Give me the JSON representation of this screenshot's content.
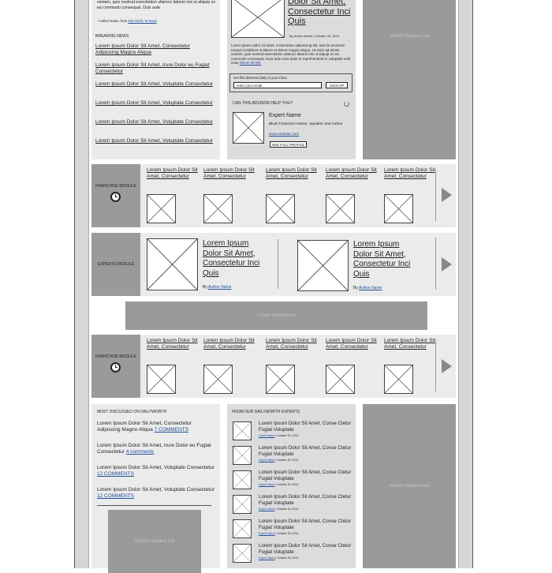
{
  "top_left": {
    "quote_text": "veniam, quis nostrud exercitation ullamco laboris nisi ut aliquip ex ea commodo consequat. Duis aute",
    "quote_attrib": "--Author Name, from ",
    "quote_link": "DW Article To Read",
    "breaking_title": "BREAKING NEWS",
    "breaking": [
      "Lorem Ipsum Dolor Sit Amet, Consectetur Adipiscing Magno Aliqua",
      "Lorem Ipsum Dolor Sit Amet, Irure Dolor eu Fugiat Consectetur",
      "Lorem Ipsum Dolor Sit Amet, Voluptate Consectetur",
      "Lorem Ipsum Dolor Sit Amet, Voluptate Consectetur",
      "Lorem Ipsum Dolor Sit Amet, Voluptate Consectetur",
      "Lorem Ipsum Dolor Sit Amet, Voluptate Consectetur"
    ]
  },
  "top_middle": {
    "headline": "Dolor Sit Amet, Consectetur Inci Quis",
    "byline": "By Author Name | October 26, 2014",
    "body": "Lorem ipsum dolor sit amet, consectetur adipisicing elit, sed do eiusmod tempor incididunt ut labore et dolore magna aliqua. Ut enim ad minim veniam, quis nostrud exercitation ullamco laboris nisi ut aliquip ex ea commodo consequat. Duis aute irure dolor in reprehenderit in voluptate velit esse ",
    "read_more": "READ MORE",
    "inbox_label": "Get this delivered daily to your inbox:",
    "email_placeholder": "enter your email",
    "signup": "SIGN UP",
    "advisor_title": "CAN THIS ADVISOR HELP YOU?",
    "expert_name": "Expert Name",
    "expert_desc": "Blurb Financial Advisor, Speaker and Author",
    "expert_site": "www.website.com",
    "see_profile": "SEE FULL PROFILE"
  },
  "ads": {
    "top_right": "300x600 Standard Unit",
    "leaderboard": "970x90 Standard Unit",
    "bottom_right": "300x600 Standard Unit",
    "bottom_left": "300x250 Standard Unit"
  },
  "franchise1": {
    "label": "FRANCHISE MODULE",
    "items": [
      "Lorem Ipsum Dolor Sit Amet, Consectetur",
      "Lorem Ipsum Dolor Sit Amet, Consectetur",
      "Lorem Ipsum Dolor Sit Amet, Consectetur",
      "Lorem Ipsum Dolor Sit Amet, Consectetur",
      "Lorem Ipsum Dolor Sit Amet, Consectetur"
    ]
  },
  "experts": {
    "label": "EXPERTS MODULE",
    "items": [
      {
        "title": "Lorem Ipsum Dolor Sit Amet, Consectetur Inci Quis",
        "by": "By ",
        "author": "Author Name"
      },
      {
        "title": "Lorem Ipsum Dolor Sit Amet, Consectetur Inci Quis",
        "by": "By ",
        "author": "Author Name"
      }
    ]
  },
  "franchise2": {
    "label": "FRANCHISE MODULE",
    "items": [
      "Lorem Ipsum Dolor Sit Amet, Consectetur",
      "Lorem Ipsum Dolor Sit Amet, Consectetur",
      "Lorem Ipsum Dolor Sit Amet, Consectetur",
      "Lorem Ipsum Dolor Sit Amet, Consectetur",
      "Lorem Ipsum Dolor Sit Amet, Consectetur"
    ]
  },
  "most_discussed": {
    "title": "MOST DISCUSSED ON DAILYWORTH",
    "items": [
      {
        "text": "Lorem Ipsum Dolor Sit Amet, Consectetur Adipiscing Magno Aliqua ",
        "comments": "7 COMMENTS"
      },
      {
        "text": "Lorem Ipsum Dolor Sit Amet, Irure Dolor eu Fugiat Consectetur ",
        "comments": "4 comments"
      },
      {
        "text": "Lorem Ipsum Dolor Sit Amet, Voluptate Consectetur ",
        "comments": "12 COMMENTS"
      },
      {
        "text": "Lorem Ipsum Dolor Sit Amet, Voluptate Consectetur ",
        "comments": "12 COMMENTS"
      }
    ]
  },
  "from_experts": {
    "title": "FROM OUR DAILYWORTH EXPERTS",
    "items": [
      {
        "title": "Lorem Ipsum Dolor Sit Amet, Conse Ctetur Fugiat Voluptate",
        "author": "Expert Name",
        "date": " | October 26, 2014"
      },
      {
        "title": "Lorem Ipsum Dolor Sit Amet, Conse Ctetur Fugiat Voluptate",
        "author": "Expert Name",
        "date": " | October 26, 2014"
      },
      {
        "title": "Lorem Ipsum Dolor Sit Amet, Conse Ctetur Fugiat Voluptate",
        "author": "Expert Name",
        "date": " | October 26, 2014"
      },
      {
        "title": "Lorem Ipsum Dolor Sit Amet, Conse Ctetur Fugiat Voluptate",
        "author": "Expert Name",
        "date": " | October 26, 2014"
      },
      {
        "title": "Lorem Ipsum Dolor Sit Amet, Conse Ctetur Fugiat Voluptate",
        "author": "Expert Name",
        "date": " | October 26, 2014"
      },
      {
        "title": "Lorem Ipsum Dolor Sit Amet, Conse Ctetur Fugiat Voluptate",
        "author": "Expert Name",
        "date": " | October 26, 2014"
      }
    ]
  },
  "icons": {
    "placeholder": "image-placeholder-icon",
    "clock": "alarm-clock-icon",
    "arrow": "next-arrow-icon"
  }
}
